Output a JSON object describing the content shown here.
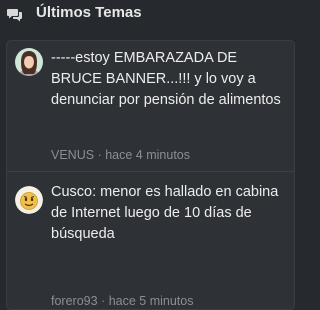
{
  "header": {
    "icon": "chat-bubbles-icon",
    "title": "Últimos Temas"
  },
  "threads": [
    {
      "title": "-----estoy EMBARAZADA DE BRUCE BANNER...!!! y lo voy a denunciar por pensión de alimentos",
      "author": "VENUS",
      "separator": "·",
      "time": "hace 4 minutos",
      "avatar": "avatar-woman"
    },
    {
      "title": "Cusco: menor es hallado en cabina de Internet luego de 10 días de búsqueda",
      "author": "forero93",
      "separator": "·",
      "time": "hace 5 minutos",
      "avatar": "avatar-emoji"
    }
  ],
  "colors": {
    "background": "#262a2e",
    "panel": "#2e3236",
    "title_text": "#ededed",
    "meta_text": "#8a8f95"
  }
}
